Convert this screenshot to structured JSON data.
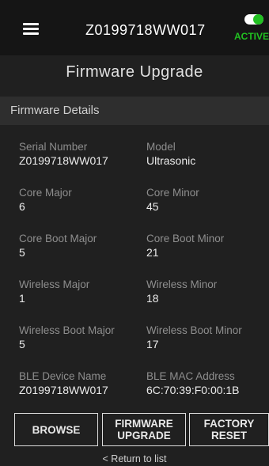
{
  "header": {
    "device_id": "Z0199718WW017",
    "status_label": "ACTIVE",
    "status_color": "#21c021",
    "menu_icon": "hamburger-menu-icon"
  },
  "page": {
    "title": "Firmware Upgrade",
    "section_title": "Firmware Details"
  },
  "details": [
    {
      "left": {
        "label": "Serial Number",
        "value": "Z0199718WW017"
      },
      "right": {
        "label": "Model",
        "value": "Ultrasonic"
      }
    },
    {
      "left": {
        "label": "Core Major",
        "value": "6"
      },
      "right": {
        "label": "Core Minor",
        "value": "45"
      }
    },
    {
      "left": {
        "label": "Core Boot Major",
        "value": "5"
      },
      "right": {
        "label": "Core Boot Minor",
        "value": "21"
      }
    },
    {
      "left": {
        "label": "Wireless Major",
        "value": "1"
      },
      "right": {
        "label": "Wireless Minor",
        "value": "18"
      }
    },
    {
      "left": {
        "label": "Wireless Boot Major",
        "value": "5"
      },
      "right": {
        "label": "Wireless Boot Minor",
        "value": "17"
      }
    },
    {
      "left": {
        "label": "BLE Device Name",
        "value": "Z0199718WW017"
      },
      "right": {
        "label": "BLE MAC Address",
        "value": "6C:70:39:F0:00:1B"
      }
    }
  ],
  "buttons": {
    "browse": "BROWSE",
    "firmware_line1": "FIRMWARE",
    "firmware_line2": "UPGRADE",
    "factory_line1": "FACTORY",
    "factory_line2": "RESET"
  },
  "footer": {
    "return_label": "< Return to list"
  }
}
